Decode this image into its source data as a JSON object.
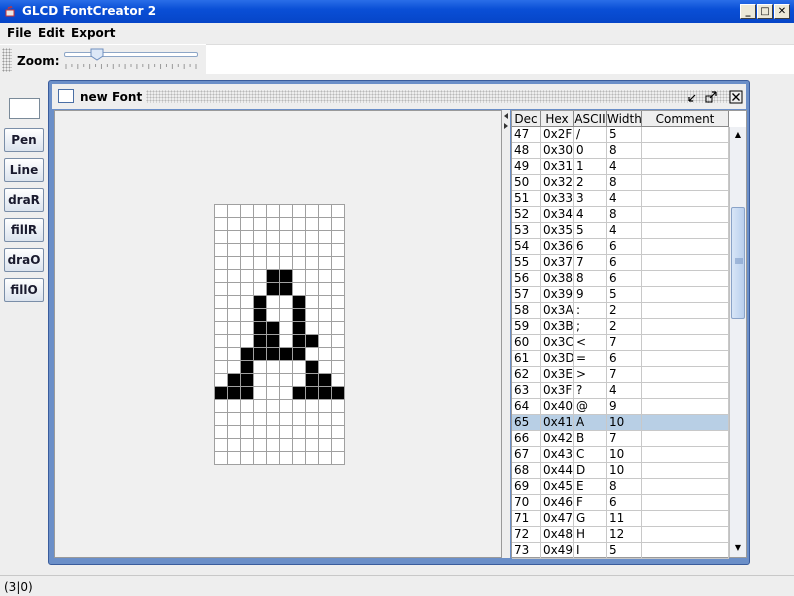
{
  "window": {
    "title": "GLCD FontCreator 2",
    "buttons": [
      "minimize",
      "maximize",
      "close"
    ]
  },
  "menu": {
    "items": [
      "File",
      "Edit",
      "Export"
    ]
  },
  "toolbar": {
    "zoom_label": "Zoom:",
    "zoom_level": 0.22
  },
  "tools": {
    "buttons": [
      "Pen",
      "Line",
      "draR",
      "fillR",
      "draO",
      "fillO"
    ]
  },
  "internal_frame": {
    "title": "new Font"
  },
  "table": {
    "headers": [
      "Dec",
      "Hex",
      "ASCII",
      "Width",
      "Comment"
    ],
    "selected_dec": "65",
    "rows": [
      [
        "47",
        "0x2F",
        "/",
        "5",
        ""
      ],
      [
        "48",
        "0x30",
        "0",
        "8",
        ""
      ],
      [
        "49",
        "0x31",
        "1",
        "4",
        ""
      ],
      [
        "50",
        "0x32",
        "2",
        "8",
        ""
      ],
      [
        "51",
        "0x33",
        "3",
        "4",
        ""
      ],
      [
        "52",
        "0x34",
        "4",
        "8",
        ""
      ],
      [
        "53",
        "0x35",
        "5",
        "4",
        ""
      ],
      [
        "54",
        "0x36",
        "6",
        "6",
        ""
      ],
      [
        "55",
        "0x37",
        "7",
        "6",
        ""
      ],
      [
        "56",
        "0x38",
        "8",
        "6",
        ""
      ],
      [
        "57",
        "0x39",
        "9",
        "5",
        ""
      ],
      [
        "58",
        "0x3A",
        ":",
        "2",
        ""
      ],
      [
        "59",
        "0x3B",
        ";",
        "2",
        ""
      ],
      [
        "60",
        "0x3C",
        "<",
        "7",
        ""
      ],
      [
        "61",
        "0x3D",
        "=",
        "6",
        ""
      ],
      [
        "62",
        "0x3E",
        ">",
        "7",
        ""
      ],
      [
        "63",
        "0x3F",
        "?",
        "4",
        ""
      ],
      [
        "64",
        "0x40",
        "@",
        "9",
        ""
      ],
      [
        "65",
        "0x41",
        "A",
        "10",
        ""
      ],
      [
        "66",
        "0x42",
        "B",
        "7",
        ""
      ],
      [
        "67",
        "0x43",
        "C",
        "10",
        ""
      ],
      [
        "68",
        "0x44",
        "D",
        "10",
        ""
      ],
      [
        "69",
        "0x45",
        "E",
        "8",
        ""
      ],
      [
        "70",
        "0x46",
        "F",
        "6",
        ""
      ],
      [
        "71",
        "0x47",
        "G",
        "11",
        ""
      ],
      [
        "72",
        "0x48",
        "H",
        "12",
        ""
      ],
      [
        "73",
        "0x49",
        "I",
        "5",
        ""
      ]
    ]
  },
  "glyph": {
    "cols": 10,
    "rows": 20,
    "pixels": [
      "..........",
      "..........",
      "..........",
      "..........",
      "..........",
      "....##....",
      "....##....",
      "...#..#...",
      "...#..#...",
      "...##.#...",
      "...##.##..",
      "..#####...",
      "..#....#..",
      ".##....##.",
      "###...####",
      "..........",
      "..........",
      "..........",
      "..........",
      ".........."
    ]
  },
  "status": {
    "text": "(3|0)"
  },
  "colors": {
    "titlebar": "#0a4fd6",
    "frame_border": "#6b8fc8",
    "selected_row": "#b8cfe5",
    "pixel_on": "#000000",
    "pixel_off": "#ffffff"
  }
}
